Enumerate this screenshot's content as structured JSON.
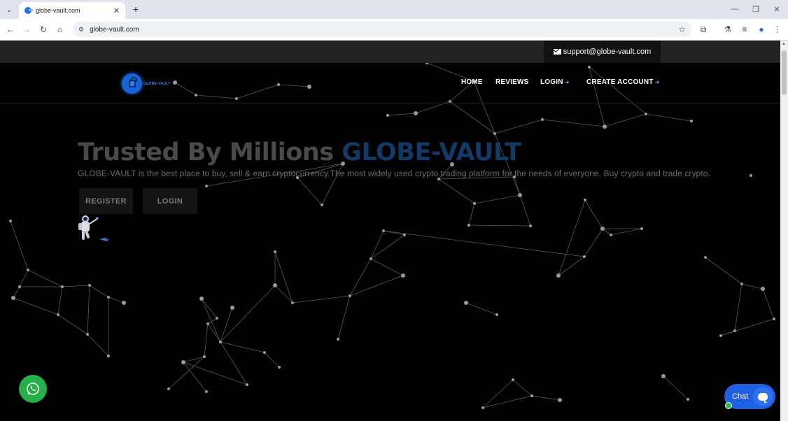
{
  "browser": {
    "tab_title": "globe-vault.com",
    "tab_close": "✕",
    "new_tab": "+",
    "url": "globe-vault.com",
    "menu_glyph": "⌄",
    "minimize": "—",
    "restore": "❐",
    "close": "✕",
    "back": "←",
    "forward": "→",
    "reload": "↻",
    "home": "⌂",
    "star": "☆",
    "extensions": "⧉",
    "labs": "⚗",
    "media": "≡",
    "profile": "●",
    "more": "⋮",
    "site_info": "⚙"
  },
  "topbar": {
    "support_email": "support@globe-vault.com"
  },
  "header": {
    "logo_text": "GLOBE-VAULT",
    "nav": [
      {
        "label": "HOME"
      },
      {
        "label": "REVIEWS"
      },
      {
        "label": "LOGIN"
      },
      {
        "label": "CREATE ACCOUNT"
      }
    ]
  },
  "hero": {
    "title_prefix": "Trusted By Millions ",
    "title_accent": "GLOBE-VAULT",
    "subtitle": "GLOBE-VAULT is the best place to buy, sell & earn cryptocurrency.The most widely used crypto trading platform for the needs of everyone. Buy crypto and trade crypto.",
    "register_label": "REGISTER",
    "login_label": "LOGIN"
  },
  "widgets": {
    "chat_label": "Chat"
  },
  "colors": {
    "accent_blue": "#1565d8",
    "whatsapp_green": "#25b04a",
    "chat_blue": "#1f5fe0"
  }
}
